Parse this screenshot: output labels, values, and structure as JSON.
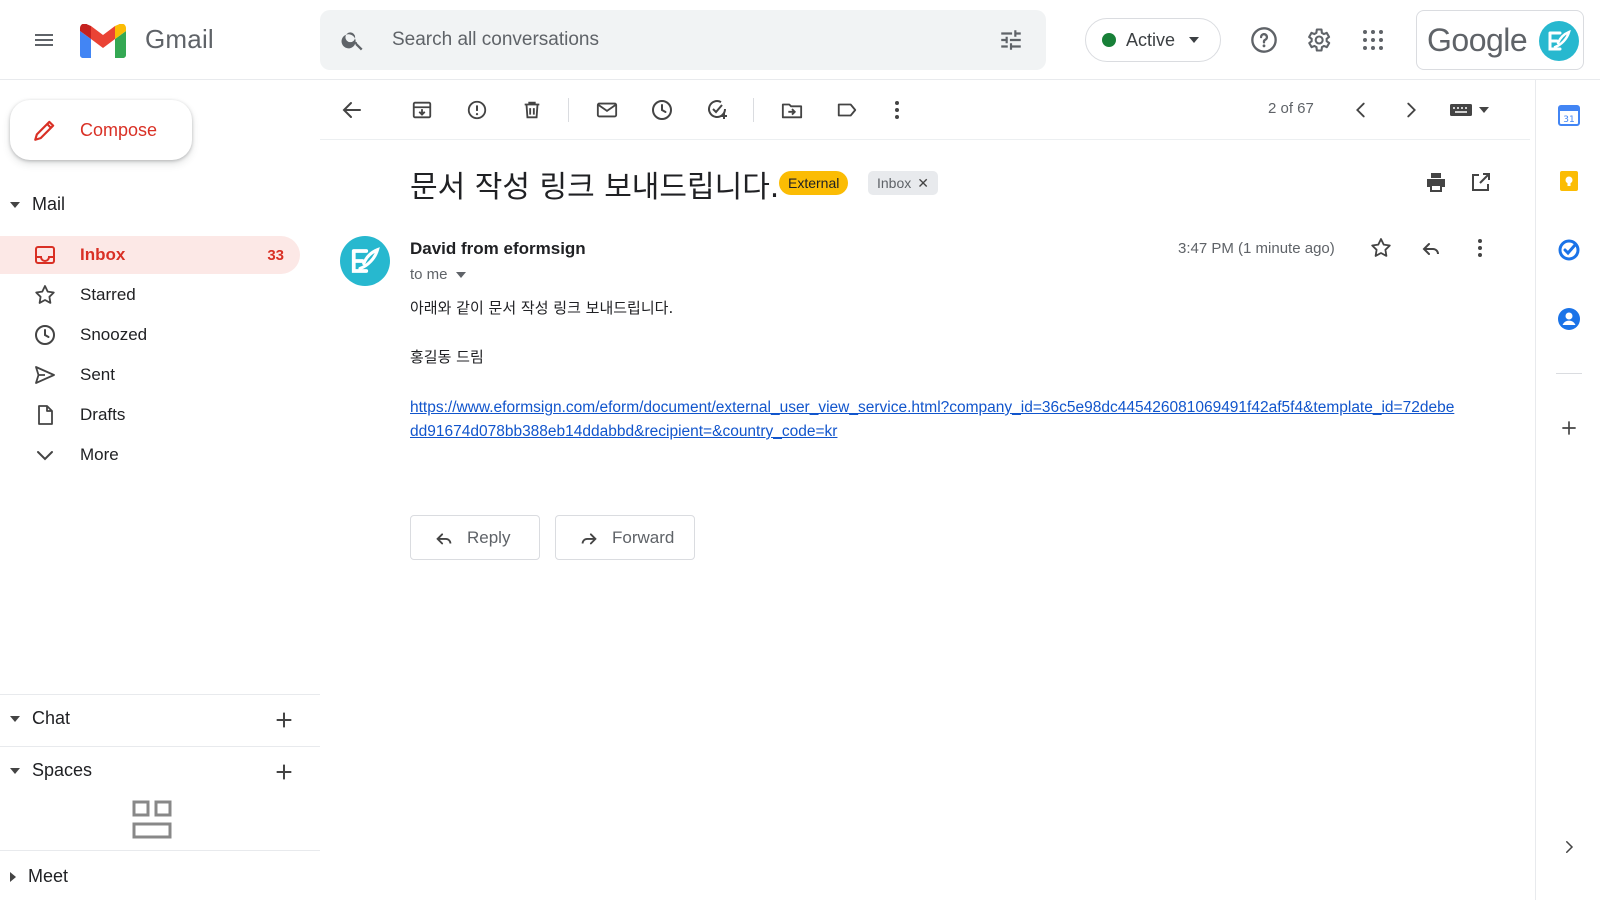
{
  "header": {
    "app_name": "Gmail",
    "search_placeholder": "Search all conversations",
    "status_label": "Active",
    "account_brand": "Google"
  },
  "colors": {
    "accent_red": "#d93025",
    "active_green": "#188038",
    "external_chip": "#fbbc04",
    "link_blue": "#1155cc",
    "avatar_teal": "#27b8cf"
  },
  "nav": {
    "compose_label": "Compose",
    "mail_section": "Mail",
    "items": [
      {
        "label": "Inbox",
        "icon": "inbox-icon",
        "count": "33",
        "active": true
      },
      {
        "label": "Starred",
        "icon": "star-icon"
      },
      {
        "label": "Snoozed",
        "icon": "clock-icon"
      },
      {
        "label": "Sent",
        "icon": "send-icon"
      },
      {
        "label": "Drafts",
        "icon": "draft-icon"
      },
      {
        "label": "More",
        "icon": "chevron-down-icon"
      }
    ],
    "chat_section": "Chat",
    "spaces_section": "Spaces",
    "meet_section": "Meet"
  },
  "toolbar": {
    "pager": "2 of 67"
  },
  "message": {
    "subject": "문서 작성 링크 보내드립니다.",
    "labels": {
      "external": "External",
      "inbox": "Inbox"
    },
    "sender": "David from eformsign",
    "recipient": "to me",
    "timestamp": "3:47 PM (1 minute ago)",
    "body_line1": "아래와 같이 문서 작성 링크 보내드립니다.",
    "body_line2": "홍길동 드림",
    "link": "https://www.eformsign.com/eform/document/external_user_view_service.html?company_id=36c5e98dc445426081069491f42af5f4&template_id=72debedd91674d078bb388eb14ddabbd&recipient=&country_code=kr"
  },
  "actions": {
    "reply": "Reply",
    "forward": "Forward"
  }
}
